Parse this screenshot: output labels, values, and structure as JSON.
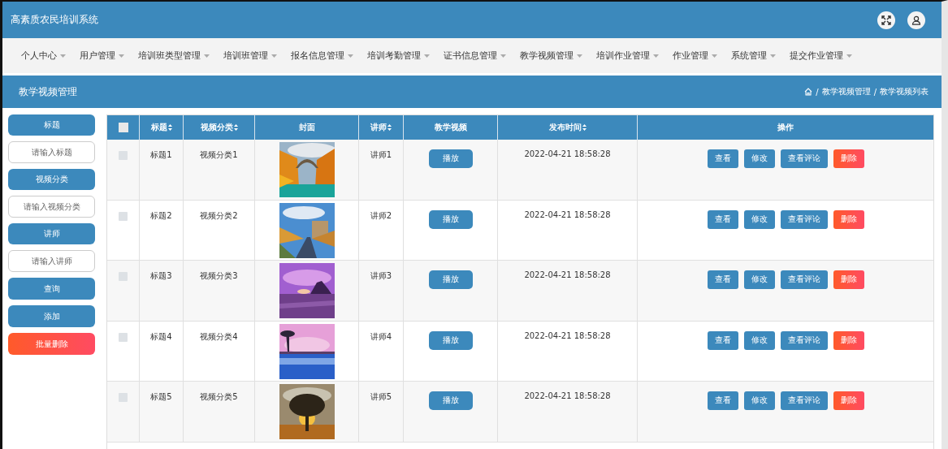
{
  "header": {
    "title": "高素质农民培训系统"
  },
  "nav": [
    {
      "label": "个人中心"
    },
    {
      "label": "用户管理"
    },
    {
      "label": "培训班类型管理"
    },
    {
      "label": "培训班管理"
    },
    {
      "label": "报名信息管理"
    },
    {
      "label": "培训考勤管理"
    },
    {
      "label": "证书信息管理"
    },
    {
      "label": "教学视频管理"
    },
    {
      "label": "培训作业管理"
    },
    {
      "label": "作业管理"
    },
    {
      "label": "系统管理"
    },
    {
      "label": "提交作业管理"
    }
  ],
  "page_bar": {
    "title": "教学视频管理",
    "breadcrumb": [
      "教学视频管理",
      "教学视频列表"
    ],
    "separator": "/"
  },
  "sidebar": [
    {
      "kind": "label",
      "text": "标题"
    },
    {
      "kind": "input",
      "placeholder": "请输入标题"
    },
    {
      "kind": "label",
      "text": "视频分类"
    },
    {
      "kind": "input",
      "placeholder": "请输入视频分类"
    },
    {
      "kind": "label",
      "text": "讲师"
    },
    {
      "kind": "input",
      "placeholder": "请输入讲师"
    },
    {
      "kind": "button",
      "text": "查询"
    },
    {
      "kind": "button",
      "text": "添加"
    },
    {
      "kind": "danger",
      "text": "批量删除"
    }
  ],
  "table": {
    "all_checked": false,
    "columns": [
      {
        "label": "标题",
        "sortable": true
      },
      {
        "label": "视频分类",
        "sortable": true
      },
      {
        "label": "封面",
        "sortable": false
      },
      {
        "label": "讲师",
        "sortable": true
      },
      {
        "label": "教学视频",
        "sortable": false
      },
      {
        "label": "发布时间",
        "sortable": true
      },
      {
        "label": "操作",
        "sortable": false
      }
    ],
    "rows": [
      {
        "checked": false,
        "title": "标题1",
        "category": "视频分类1",
        "cover": {
          "kind": "picture"
        },
        "teacher": "讲师1",
        "video": "播放",
        "time": "2022-04-21 18:58:28",
        "actions": [
          {
            "label": "查看",
            "kind": "primary"
          },
          {
            "label": "修改",
            "kind": "primary"
          },
          {
            "label": "查看评论",
            "kind": "primary"
          },
          {
            "label": "删除",
            "kind": "danger"
          }
        ]
      },
      {
        "checked": false,
        "title": "标题2",
        "category": "视频分类2",
        "cover": {
          "kind": "picture"
        },
        "teacher": "讲师2",
        "video": "播放",
        "time": "2022-04-21 18:58:28",
        "actions": [
          {
            "label": "查看",
            "kind": "primary"
          },
          {
            "label": "修改",
            "kind": "primary"
          },
          {
            "label": "查看评论",
            "kind": "primary"
          },
          {
            "label": "删除",
            "kind": "danger"
          }
        ]
      },
      {
        "checked": false,
        "title": "标题3",
        "category": "视频分类3",
        "cover": {
          "kind": "picture"
        },
        "teacher": "讲师3",
        "video": "播放",
        "time": "2022-04-21 18:58:28",
        "actions": [
          {
            "label": "查看",
            "kind": "primary"
          },
          {
            "label": "修改",
            "kind": "primary"
          },
          {
            "label": "查看评论",
            "kind": "primary"
          },
          {
            "label": "删除",
            "kind": "danger"
          }
        ]
      },
      {
        "checked": false,
        "title": "标题4",
        "category": "视频分类4",
        "cover": {
          "kind": "picture"
        },
        "teacher": "讲师4",
        "video": "播放",
        "time": "2022-04-21 18:58:28",
        "actions": [
          {
            "label": "查看",
            "kind": "primary"
          },
          {
            "label": "修改",
            "kind": "primary"
          },
          {
            "label": "查看评论",
            "kind": "primary"
          },
          {
            "label": "删除",
            "kind": "danger"
          }
        ]
      },
      {
        "checked": false,
        "title": "标题5",
        "category": "视频分类5",
        "cover": {
          "kind": "picture"
        },
        "teacher": "讲师5",
        "video": "播放",
        "time": "2022-04-21 18:58:28",
        "actions": [
          {
            "label": "查看",
            "kind": "primary"
          },
          {
            "label": "修改",
            "kind": "primary"
          },
          {
            "label": "查看评论",
            "kind": "primary"
          },
          {
            "label": "删除",
            "kind": "danger"
          }
        ]
      }
    ]
  }
}
